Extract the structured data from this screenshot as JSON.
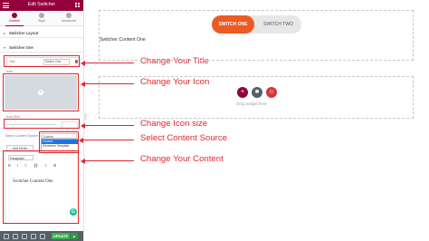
{
  "panel": {
    "header_title": "Edit Switcher",
    "tabs": [
      {
        "label": "Content"
      },
      {
        "label": "Style"
      },
      {
        "label": "Advanced"
      }
    ],
    "sections": {
      "layout": "Switcher Layout",
      "one": "Switcher One"
    },
    "fields": {
      "title_label": "Title",
      "title_value": "Switch One",
      "icon_label": "Icon",
      "icon_size_label": "Icon Size",
      "content_source_label": "Select Content Source",
      "content_source_value": "Custom",
      "content_source_options": [
        "Custom",
        "Elementor Template"
      ],
      "add_media_label": "Add Media",
      "paragraph_format": "Paragraph",
      "toolbar_glyphs": "B I ≡ ⛓ ≡ ⊞",
      "editor_content": "Switcher Content One"
    },
    "footer": {
      "update_label": "UPDATE",
      "update_caret": "▲"
    }
  },
  "annotations": {
    "title": "Change Your Title",
    "icon": "Change Your Icon",
    "icon_size": "Change Icon size",
    "content_source": "Select Content Source",
    "content": "Change Your Content"
  },
  "preview": {
    "switch_one": "SWITCH ONE",
    "switch_two": "SWITCH TWO",
    "content_one": "Switcher Content One",
    "drag_text": "Drag widget here",
    "add_icons": [
      "+",
      "■",
      "☺"
    ]
  },
  "colors": {
    "brand": "#93003c",
    "annotation": "#e3242b",
    "switch_active": "#ee5a24",
    "update": "#39b54a"
  }
}
